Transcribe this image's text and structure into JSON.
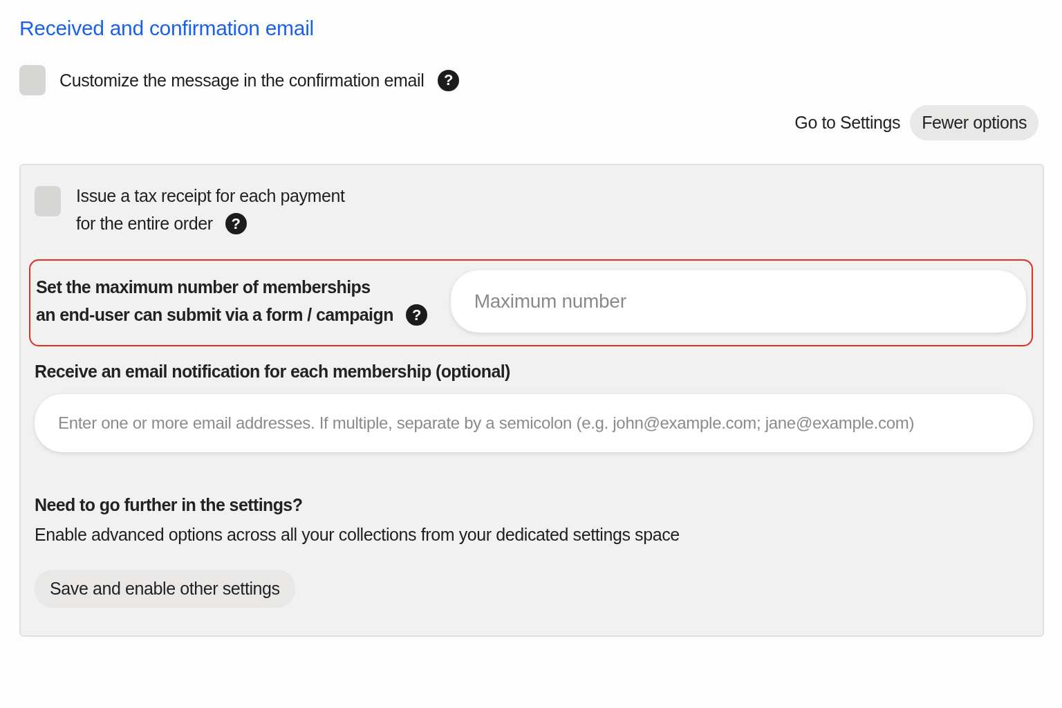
{
  "section_title": "Received and confirmation email",
  "customize": {
    "label": "Customize the message in the confirmation email",
    "checked": false,
    "help": "?"
  },
  "actions": [
    {
      "kind": "link",
      "label": "Go to Settings"
    },
    {
      "kind": "button",
      "label": "Fewer options"
    }
  ],
  "tax_receipt": {
    "label_lines": [
      "Issue a tax receipt for each payment",
      "for the entire order"
    ],
    "checked": false,
    "help": "?"
  },
  "max_memberships": {
    "label_lines": [
      "Set the maximum number of memberships",
      "an end-user can submit via a form / campaign"
    ],
    "help": "?",
    "placeholder": "Maximum number",
    "highlighted": true
  },
  "notification": {
    "label": "Receive an email notification for each membership (optional)",
    "placeholder": "Enter one or more email addresses. If multiple, separate by a semicolon (e.g. john@example.com; jane@example.com)"
  },
  "further": {
    "title": "Need to go further in the settings?",
    "text": "Enable advanced options across all your collections from your dedicated settings space",
    "button": "Save and enable other settings"
  }
}
